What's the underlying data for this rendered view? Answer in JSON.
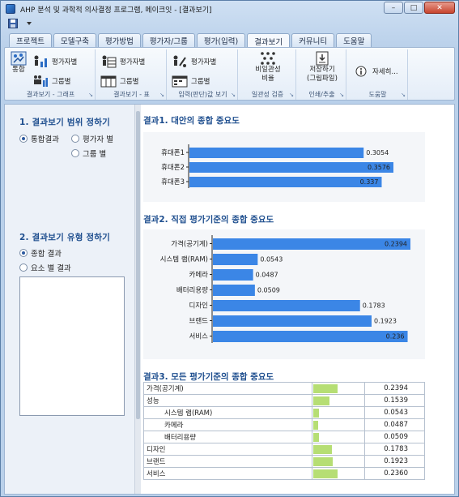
{
  "window": {
    "title": "AHP 분석 및 과학적 의사결정 프로그램, 메이크잇 - [결과보기]",
    "buttons": {
      "minimize": "–",
      "maximize": "□",
      "close": "✕"
    }
  },
  "quick_access": {
    "icon_a": "save-icon",
    "icon_b": "dropdown-icon"
  },
  "tabs": [
    {
      "label": "프로젝트"
    },
    {
      "label": "모델구축"
    },
    {
      "label": "평가방법"
    },
    {
      "label": "평가자/그룹"
    },
    {
      "label": "평가(입력)"
    },
    {
      "label": "결과보기",
      "active": true
    },
    {
      "label": "커뮤니티"
    },
    {
      "label": "도움말"
    }
  ],
  "ribbon": {
    "groups": [
      {
        "label": "결과보기 - 그래프",
        "buttons": [
          "통합",
          "평가자별",
          "그룹별"
        ]
      },
      {
        "label": "결과보기 - 표",
        "buttons": [
          "평가자별",
          "그룹별"
        ]
      },
      {
        "label": "입력(판단)값 보기",
        "buttons": [
          "평가자별",
          "그룹별"
        ]
      },
      {
        "label": "일관성 검증",
        "buttons": [
          "비일관성",
          "비율"
        ]
      },
      {
        "label": "인쇄/추출",
        "buttons": [
          "저장하기",
          "(그림파일)"
        ]
      },
      {
        "label": "도움말",
        "buttons": [
          "자세히..."
        ]
      }
    ]
  },
  "left_panel": {
    "scope_title": "1. 결과보기 범위 정하기",
    "scope_options": [
      "통합결과",
      "평가자 별",
      "그룹 별"
    ],
    "type_title": "2. 결과보기 유형 정하기",
    "type_options": [
      "종합 결과",
      "요소 별 결과"
    ]
  },
  "results": {
    "r1_title": "결과1. 대안의 종합 중요도",
    "r2_title": "결과2. 직접 평가기준의 종합 중요도",
    "r3_title": "결과3. 모든 평가기준의 종합 중요도"
  },
  "colors": {
    "bar": "#3b86e6",
    "table_bar": "#b6de74",
    "title": "#1f4f8f"
  },
  "chart_data": [
    {
      "type": "bar",
      "orientation": "horizontal",
      "title": "결과1. 대안의 종합 중요도",
      "categories": [
        "휴대폰1",
        "휴대폰2",
        "휴대폰3"
      ],
      "values": [
        0.3054,
        0.3576,
        0.337
      ],
      "labels": [
        "0.3054",
        "0.3576",
        "0.337"
      ],
      "xlim": [
        0,
        0.3576
      ]
    },
    {
      "type": "bar",
      "orientation": "horizontal",
      "title": "결과2. 직접 평가기준의 종합 중요도",
      "categories": [
        "가격(공기계)",
        "시스템 램(RAM)",
        "카메라",
        "배터리용량",
        "디자인",
        "브랜드",
        "서비스"
      ],
      "values": [
        0.2394,
        0.0543,
        0.0487,
        0.0509,
        0.1783,
        0.1923,
        0.236
      ],
      "labels": [
        "0.2394",
        "0.0543",
        "0.0487",
        "0.0509",
        "0.1783",
        "0.1923",
        "0.236"
      ],
      "xlim": [
        0,
        0.2394
      ]
    },
    {
      "type": "table",
      "title": "결과3. 모든 평가기준의 종합 중요도",
      "rows": [
        {
          "name": "가격(공기계)",
          "indent": 0,
          "value": 0.2394,
          "label": "0.2394"
        },
        {
          "name": "성능",
          "indent": 0,
          "value": 0.1539,
          "label": "0.1539"
        },
        {
          "name": "시스템 램(RAM)",
          "indent": 1,
          "value": 0.0543,
          "label": "0.0543"
        },
        {
          "name": "카메라",
          "indent": 1,
          "value": 0.0487,
          "label": "0.0487"
        },
        {
          "name": "배터리용량",
          "indent": 1,
          "value": 0.0509,
          "label": "0.0509"
        },
        {
          "name": "디자인",
          "indent": 0,
          "value": 0.1783,
          "label": "0.1783"
        },
        {
          "name": "브랜드",
          "indent": 0,
          "value": 0.1923,
          "label": "0.1923"
        },
        {
          "name": "서비스",
          "indent": 0,
          "value": 0.236,
          "label": "0.2360"
        }
      ]
    }
  ]
}
